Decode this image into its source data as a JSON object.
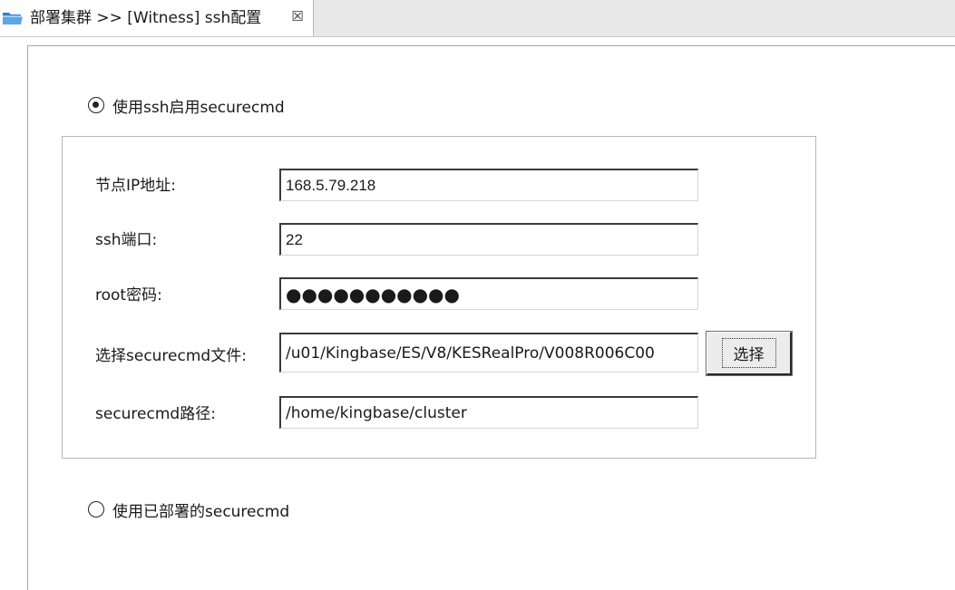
{
  "tab": {
    "title": "部署集群 >> [Witness] ssh配置",
    "close_glyph": "☒",
    "icon": "folder-icon"
  },
  "options": {
    "use_ssh": {
      "label": "使用ssh启用securecmd",
      "checked": true
    },
    "use_deployed": {
      "label": "使用已部署的securecmd",
      "checked": false
    }
  },
  "form": {
    "node_ip": {
      "label": "节点IP地址:",
      "value": "168.5.79.218"
    },
    "ssh_port": {
      "label": "ssh端口:",
      "value": "22"
    },
    "root_password": {
      "label": "root密码:",
      "value": "●●●●●●●●●●●"
    },
    "securecmd_file": {
      "label": "选择securecmd文件:",
      "value": "/u01/Kingbase/ES/V8/KESRealPro/V008R006C00",
      "button_label": "选择"
    },
    "securecmd_path": {
      "label": "securecmd路径:",
      "value": "/home/kingbase/cluster"
    }
  },
  "colors": {
    "folder_icon": "#3f8fd6",
    "tabstrip_bg": "#e8e8e8",
    "button_bg": "#ececec"
  }
}
